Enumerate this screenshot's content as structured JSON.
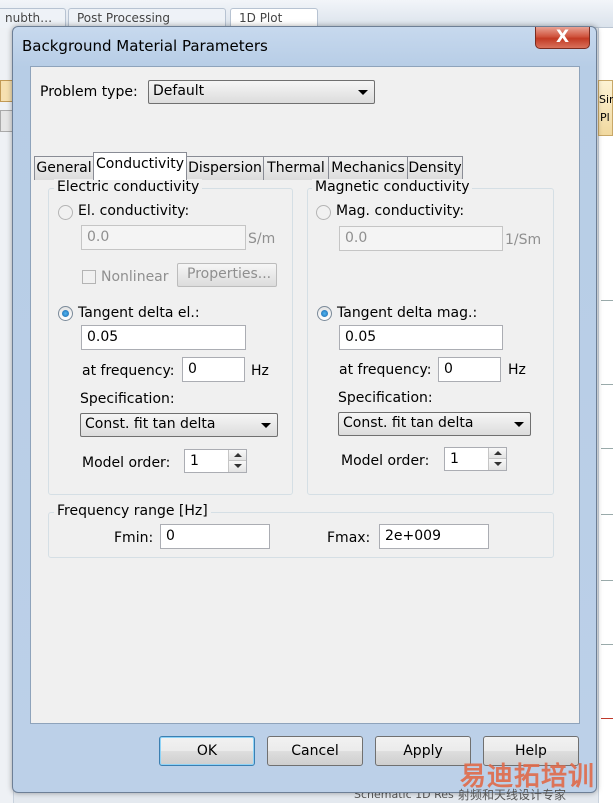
{
  "background": {
    "tabs": [
      "nubth…",
      "Post Processing",
      "1D Plot"
    ],
    "right_text": [
      "Sin",
      "Pl"
    ],
    "bottom_text": "Schematic  1D Res"
  },
  "dialog": {
    "title": "Background Material Parameters",
    "close_label": "X",
    "problem_type": {
      "label": "Problem type:",
      "value": "Default"
    },
    "tabs": [
      {
        "label": "General"
      },
      {
        "label": "Conductivity"
      },
      {
        "label": "Dispersion"
      },
      {
        "label": "Thermal"
      },
      {
        "label": "Mechanics"
      },
      {
        "label": "Density"
      }
    ],
    "active_tab": "Conductivity",
    "electric": {
      "group_title": "Electric conductivity",
      "el_cond_label": "El. conductivity:",
      "el_cond_value": "0.0",
      "el_cond_unit": "S/m",
      "nonlinear_label": "Nonlinear",
      "properties_label": "Properties...",
      "tan_label": "Tangent delta el.:",
      "tan_value": "0.05",
      "freq_label": "at frequency:",
      "freq_value": "0",
      "freq_unit": "Hz",
      "spec_label": "Specification:",
      "spec_value": "Const. fit tan delta",
      "model_order_label": "Model order:",
      "model_order_value": "1"
    },
    "magnetic": {
      "group_title": "Magnetic conductivity",
      "mag_cond_label": "Mag. conductivity:",
      "mag_cond_value": "0.0",
      "mag_cond_unit": "1/Sm",
      "tan_label": "Tangent delta mag.:",
      "tan_value": "0.05",
      "freq_label": "at frequency:",
      "freq_value": "0",
      "freq_unit": "Hz",
      "spec_label": "Specification:",
      "spec_value": "Const. fit tan delta",
      "model_order_label": "Model order:",
      "model_order_value": "1"
    },
    "freq_range": {
      "group_title": "Frequency range [Hz]",
      "fmin_label": "Fmin:",
      "fmin_value": "0",
      "fmax_label": "Fmax:",
      "fmax_value": "2e+009"
    },
    "buttons": {
      "ok": "OK",
      "cancel": "Cancel",
      "apply": "Apply",
      "help": "Help"
    }
  },
  "watermark": {
    "main": "易迪拓培训",
    "sub": "射频和天线设计专家"
  }
}
